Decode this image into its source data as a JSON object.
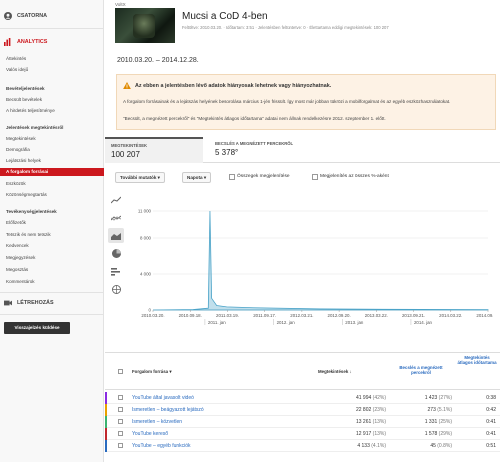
{
  "sidebar": {
    "channel_label": "CSATORNA",
    "analytics_label": "ANALYTICS",
    "create_label": "LÉTREHOZÁS",
    "items": [
      {
        "label": "Áttekintés",
        "bold": false
      },
      {
        "label": "Valós idejű",
        "bold": false
      },
      {
        "label": "Bevételjelentések",
        "bold": true
      },
      {
        "label": "Becsült bevételek",
        "bold": false
      },
      {
        "label": "A hirdetés teljesítménye",
        "bold": false
      },
      {
        "label": "Jelentések megtekintésről",
        "bold": true
      },
      {
        "label": "Megtekintések",
        "bold": false
      },
      {
        "label": "Demográfia",
        "bold": false
      },
      {
        "label": "Lejátszási helyek",
        "bold": false
      },
      {
        "label": "A forgalom forrásai",
        "bold": false,
        "active": true
      },
      {
        "label": "Eszközök",
        "bold": false
      },
      {
        "label": "Közönségmegtartás",
        "bold": false
      },
      {
        "label": "Tevékenységjelentések",
        "bold": true
      },
      {
        "label": "Előfizetők",
        "bold": false
      },
      {
        "label": "Tetszik és nem tetszik",
        "bold": false
      },
      {
        "label": "Kedvencek",
        "bold": false
      },
      {
        "label": "Megjegyzések",
        "bold": false
      },
      {
        "label": "Megosztás",
        "bold": false
      },
      {
        "label": "Kommentárok",
        "bold": false
      }
    ],
    "back_button": "Visszajelzés küldése"
  },
  "header": {
    "breadcrumb": "VoltX",
    "video_title": "Mucsi a CoD 4-ben",
    "video_meta": "Feltöltve: 2010.03.20.  ·  Időtartam: 3:51  ·  Jelentésben feltüntetve: 0  ·  Élettartama eddigi megtekintések: 100 207",
    "date_range": "2010.03.20. – 2014.12.28."
  },
  "warning": {
    "title": "Az ebben a jelentésben lévő adatok hiányosak lehetnek vagy hiányozhatnak.",
    "p1": "A forgalom forrásainak és a lejátszás helyének besorolása március 1-jén frissült. Így most már jobban tükrözi a mobilforgalmat és az egyéb eszközhasználatokat.",
    "p2": "\"Becsült, a megnézett percekről\" és \"Megtekintés átlagos időtartama\" adatai nem állnak rendelkezésre 2012. szeptember 1. előtt."
  },
  "metrics": [
    {
      "label": "MEGTEKINTÉSEK",
      "value": "100 207"
    },
    {
      "label": "BECSLÉS A MEGNÉZETT PERCEKRŐL",
      "value": "5 378°"
    }
  ],
  "toolbar": {
    "dropdown1": "További mutatók ▾",
    "dropdown2": "Napota ▾",
    "check1": "Összegek megjelenítése",
    "check2": "Megjelenítés az összes %-aként"
  },
  "chart_data": {
    "type": "area",
    "color": "#4aa3c8",
    "x": [
      "2010.03.20.",
      "2010.09.18.",
      "2011.03.19.",
      "2011.09.17.",
      "2012.03.21.",
      "2012.09.20.",
      "2013.03.22.",
      "2013.09.21.",
      "2014.03.22.",
      "2014.09.22."
    ],
    "sub_labels": [
      "2011. jan",
      "2012. jan",
      "2013. jan",
      "2014. jan"
    ],
    "y_ticks": [
      "11 000",
      "8 000",
      "4 000",
      "0"
    ],
    "ylim": [
      0,
      11000
    ],
    "points": [
      {
        "x": 0.0,
        "y": 0
      },
      {
        "x": 0.12,
        "y": 50
      },
      {
        "x": 0.165,
        "y": 200
      },
      {
        "x": 0.17,
        "y": 11000
      },
      {
        "x": 0.175,
        "y": 1300
      },
      {
        "x": 0.19,
        "y": 500
      },
      {
        "x": 0.22,
        "y": 350
      },
      {
        "x": 0.3,
        "y": 250
      },
      {
        "x": 0.5,
        "y": 120
      },
      {
        "x": 0.8,
        "y": 60
      },
      {
        "x": 1.0,
        "y": 40
      }
    ]
  },
  "table": {
    "headers": {
      "source": "Forgalom forrása ▾",
      "views": "Megtekintések ↓",
      "minutes": "Becslés a megnézett percekről",
      "avg": "Megtekintés átlagos időtartama"
    },
    "rows": [
      {
        "source": "YouTube által javasolt videó",
        "views": "41 994",
        "views_pct": "(42%)",
        "minutes": "1 423",
        "minutes_pct": "(27%)",
        "avg": "0:38",
        "color": "#8a2be2"
      },
      {
        "source": "Ismeretlen – beágyazott lejátszó",
        "views": "22 802",
        "views_pct": "(23%)",
        "minutes": "273",
        "minutes_pct": "(5.1%)",
        "avg": "0:42",
        "color": "#e8a000"
      },
      {
        "source": "Ismeretlen – közvetlen",
        "views": "13 261",
        "views_pct": "(13%)",
        "minutes": "1 331",
        "minutes_pct": "(25%)",
        "avg": "0:41",
        "color": "#3cb371"
      },
      {
        "source": "YouTube kereső",
        "views": "12 917",
        "views_pct": "(13%)",
        "minutes": "1 578",
        "minutes_pct": "(29%)",
        "avg": "0:41",
        "color": "#c1272d"
      },
      {
        "source": "YouTube – egyéb funkciók",
        "views": "4 133",
        "views_pct": "(4.1%)",
        "minutes": "45",
        "minutes_pct": "(0.8%)",
        "avg": "0:51",
        "color": "#2a6bbf"
      }
    ]
  }
}
